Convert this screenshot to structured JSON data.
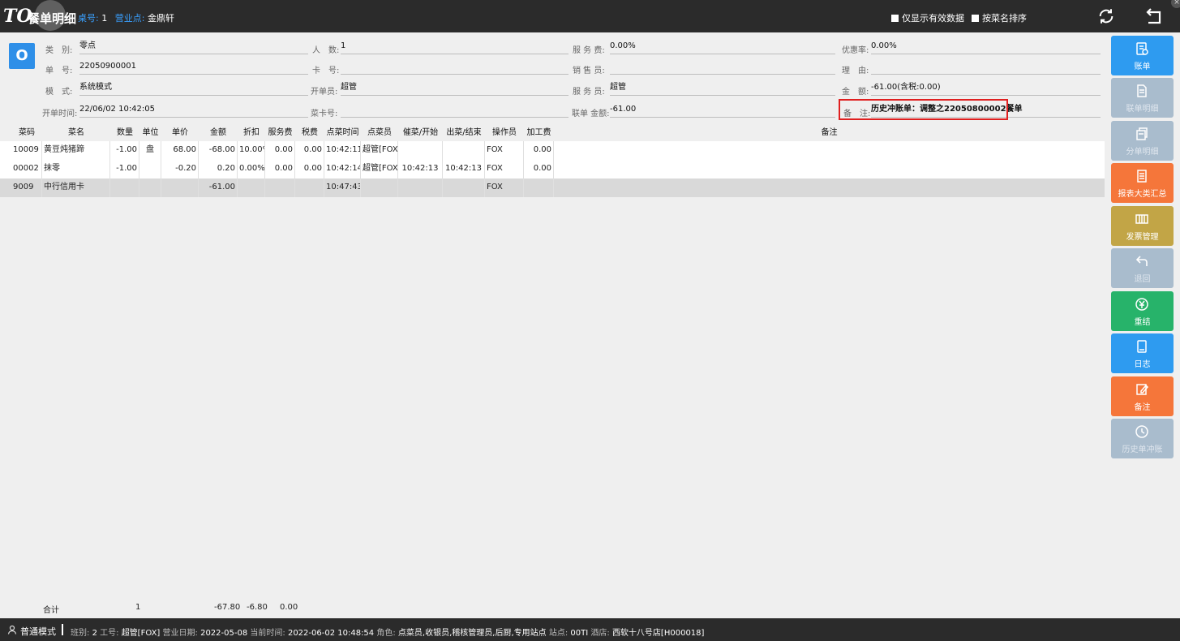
{
  "header": {
    "logo": "TO",
    "title": "餐单明细",
    "table_label": "桌号:",
    "table_value": "1",
    "outlet_label": "营业点:",
    "outlet_value": "金鼎轩",
    "check_valid_only": "仅显示有效数据",
    "check_sort_name": "按菜名排序"
  },
  "badge": "O",
  "info": {
    "category_label": "类　别:",
    "category_value": "零点",
    "order_no_label": "单　号:",
    "order_no_value": "22050900001",
    "mode_label": "模　式:",
    "mode_value": "系统模式",
    "open_time_label": "开单时间:",
    "open_time_value": "22/06/02 10:42:05",
    "guests_label": "人　数:",
    "guests_value": "1",
    "card_label": "卡　号:",
    "card_value": "",
    "opener_label": "开单员:",
    "opener_value": "超管",
    "menu_card_label": "菜卡号:",
    "menu_card_value": "",
    "service_fee_label": "服 务 费:",
    "service_fee_value": "0.00%",
    "sales_label": "销 售 员:",
    "sales_value": "",
    "waiter_label": "服 务 员:",
    "waiter_value": "超管",
    "joint_amount_label": "联单 金额:",
    "joint_amount_value": "-61.00",
    "discount_rate_label": "优惠率:",
    "discount_rate_value": "0.00%",
    "reason_label": "理　由:",
    "reason_value": "",
    "amount_label": "金　额:",
    "amount_value": "-61.00(含税:0.00)",
    "remark_label": "备　注:",
    "remark_value": "历史冲账单：调整之22050800002餐单"
  },
  "table": {
    "headers": [
      "菜码",
      "菜名",
      "数量",
      "单位",
      "单价",
      "金额",
      "折扣",
      "服务费",
      "税费",
      "点菜时间",
      "点菜员",
      "催菜/开始",
      "出菜/结束",
      "操作员",
      "加工费",
      "备注"
    ],
    "rows": [
      [
        "10009",
        "黄豆炖猪蹄",
        "-1.00",
        "盘",
        "68.00",
        "-68.00",
        "10.00%",
        "0.00",
        "0.00",
        "10:42:11",
        "超管[FOX]",
        "",
        "",
        "FOX",
        "0.00",
        ""
      ],
      [
        "00002",
        "抹零",
        "-1.00",
        "",
        "-0.20",
        "0.20",
        "0.00%",
        "0.00",
        "0.00",
        "10:42:14",
        "超管[FOX]",
        "10:42:13",
        "10:42:13",
        "FOX",
        "0.00",
        ""
      ],
      [
        "9009",
        "中行信用卡",
        "",
        "",
        "",
        "-61.00",
        "",
        "",
        "",
        "10:47:43",
        "",
        "",
        "",
        "FOX",
        "",
        ""
      ]
    ]
  },
  "totals": {
    "label": "合计",
    "qty": "1",
    "amount": "-67.80",
    "discount": "-6.80",
    "service": "0.00"
  },
  "status": {
    "mode": "普通模式",
    "shift_label": "班别:",
    "shift_value": "2",
    "emp_label": "工号:",
    "emp_value": "超管[FOX]",
    "bizdate_label": "营业日期:",
    "bizdate_value": "2022-05-08",
    "now_label": "当前时间:",
    "now_value": "2022-06-02 10:48:54",
    "role_label": "角色:",
    "role_value": "点菜员,收银员,稽核管理员,后厨,专用站点",
    "station_label": "站点:",
    "station_value": "00TI",
    "hotel_label": "酒店:",
    "hotel_value": "西软十八号店[H000018]"
  },
  "side_buttons": [
    {
      "label": "账单",
      "color": "#2e9bf0",
      "icon": "bill-icon",
      "enabled": true
    },
    {
      "label": "联单明细",
      "color": "#a9bccd",
      "icon": "document-icon",
      "enabled": false
    },
    {
      "label": "分单明细",
      "color": "#a9bccd",
      "icon": "split-icon",
      "enabled": false
    },
    {
      "label": "报表大类汇总",
      "color": "#f5763a",
      "icon": "report-icon",
      "enabled": true
    },
    {
      "label": "发票管理",
      "color": "#c2a546",
      "icon": "invoice-icon",
      "enabled": true
    },
    {
      "label": "退回",
      "color": "#a9bccd",
      "icon": "return-icon",
      "enabled": false
    },
    {
      "label": "重结",
      "color": "#27b36a",
      "icon": "yen-icon",
      "enabled": true
    },
    {
      "label": "日志",
      "color": "#2e9bf0",
      "icon": "log-icon",
      "enabled": true
    },
    {
      "label": "备注",
      "color": "#f5763a",
      "icon": "edit-icon",
      "enabled": true
    },
    {
      "label": "历史单冲账",
      "color": "#a9bccd",
      "icon": "history-icon",
      "enabled": false
    }
  ]
}
